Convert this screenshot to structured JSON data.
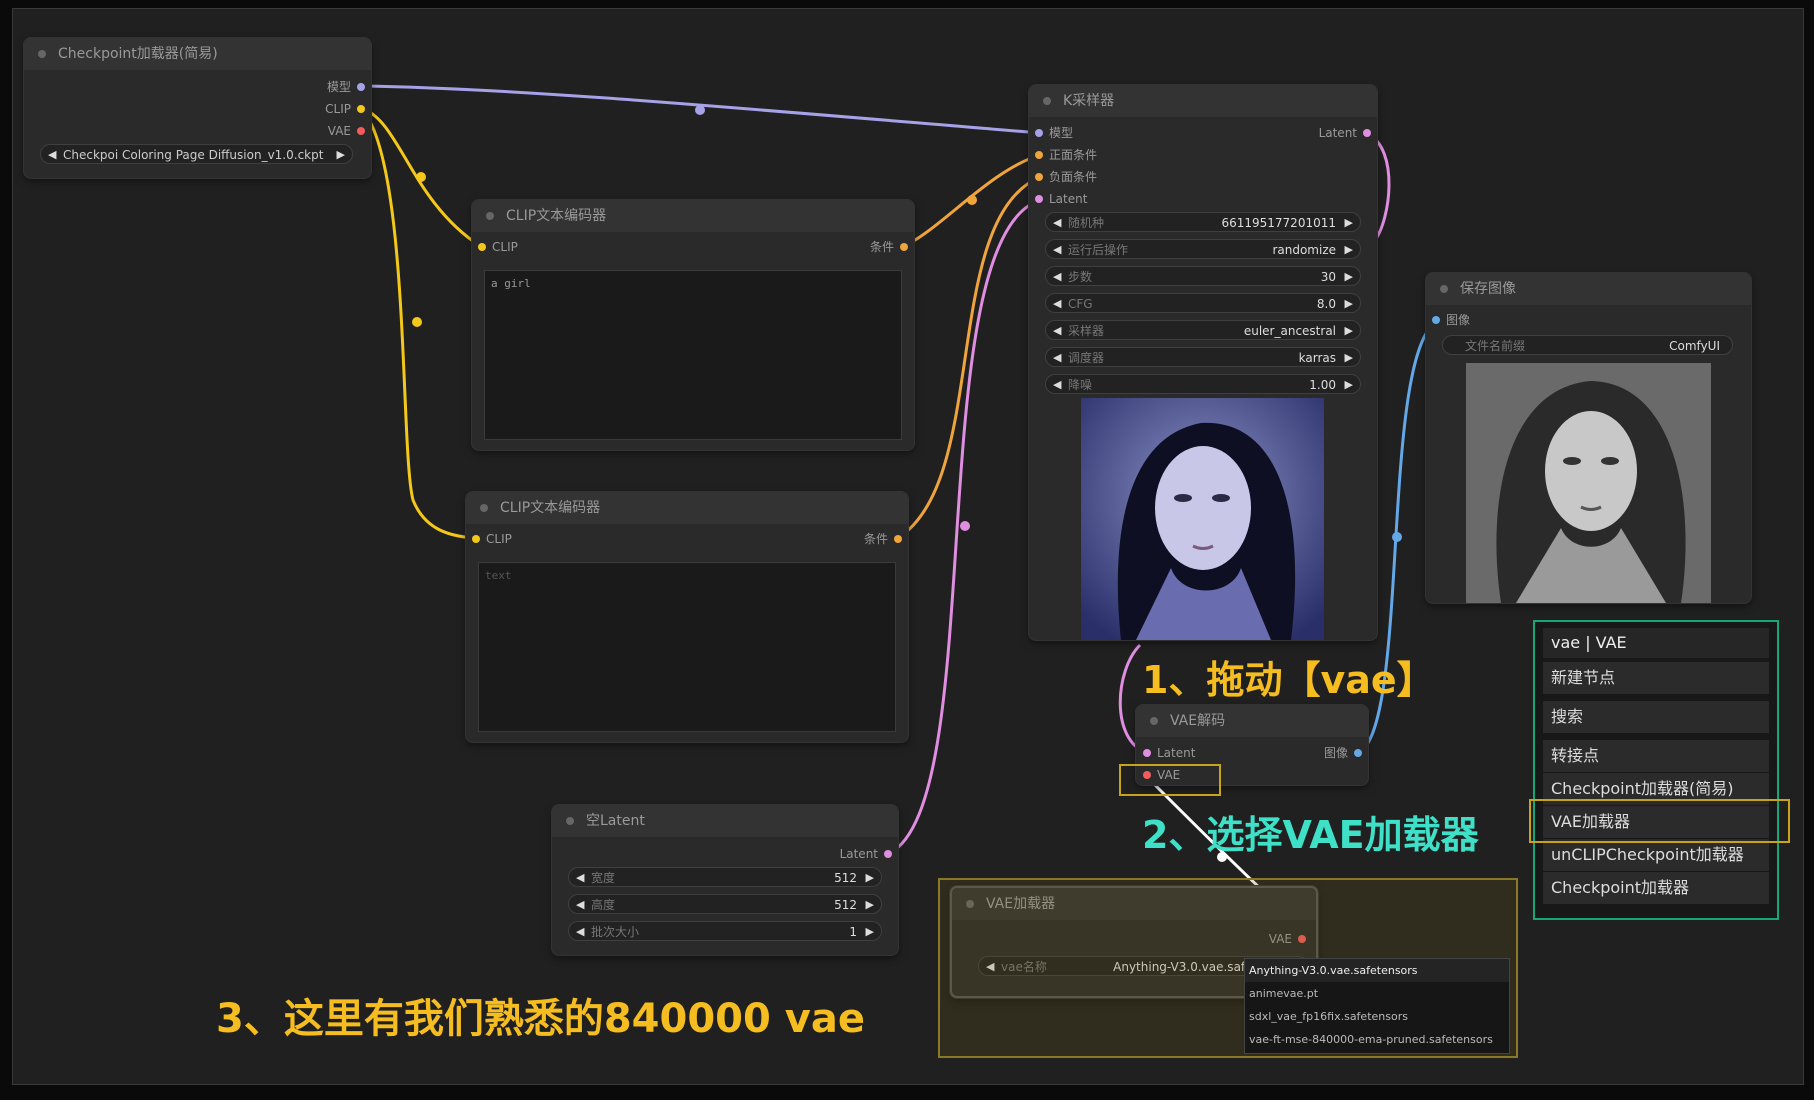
{
  "nodes": {
    "checkpoint": {
      "title": "Checkpoint加载器(简易)",
      "out_model": "模型",
      "out_clip": "CLIP",
      "out_vae": "VAE",
      "ckpt_value": "Checkpoi Coloring Page Diffusion_v1.0.ckpt"
    },
    "clip_pos": {
      "title": "CLIP文本编码器",
      "in_clip": "CLIP",
      "out_cond": "条件",
      "text": "a girl"
    },
    "clip_neg": {
      "title": "CLIP文本编码器",
      "in_clip": "CLIP",
      "out_cond": "条件",
      "placeholder": "text"
    },
    "ksampler": {
      "title": "K采样器",
      "in_model": "模型",
      "in_positive": "正面条件",
      "in_negative": "负面条件",
      "in_latent": "Latent",
      "out_latent": "Latent",
      "widgets": [
        {
          "label": "随机种",
          "value": "661195177201011"
        },
        {
          "label": "运行后操作",
          "value": "randomize"
        },
        {
          "label": "步数",
          "value": "30"
        },
        {
          "label": "CFG",
          "value": "8.0"
        },
        {
          "label": "采样器",
          "value": "euler_ancestral"
        },
        {
          "label": "调度器",
          "value": "karras"
        },
        {
          "label": "降噪",
          "value": "1.00"
        }
      ]
    },
    "save_image": {
      "title": "保存图像",
      "in_image": "图像",
      "filename_label": "文件名前缀",
      "filename_value": "ComfyUI"
    },
    "vae_decode": {
      "title": "VAE解码",
      "in_latent": "Latent",
      "in_vae": "VAE",
      "out_image": "图像"
    },
    "empty_latent": {
      "title": "空Latent",
      "out_latent": "Latent",
      "widgets": [
        {
          "label": "宽度",
          "value": "512"
        },
        {
          "label": "高度",
          "value": "512"
        },
        {
          "label": "批次大小",
          "value": "1"
        }
      ]
    },
    "vae_loader": {
      "title": "VAE加载器",
      "out_vae": "VAE",
      "widget_label": "vae名称",
      "widget_value": "Anything-V3.0.vae.safetensors"
    }
  },
  "dropdown": {
    "options": [
      "Anything-V3.0.vae.safetensors",
      "animevae.pt",
      "sdxl_vae_fp16fix.safetensors",
      "vae-ft-mse-840000-ema-pruned.safetensors"
    ],
    "selected_index": 0
  },
  "search_menu": {
    "query": "vae | VAE",
    "items": [
      "新建节点",
      "搜索",
      "转接点",
      "Checkpoint加载器(简易)",
      "VAE加载器",
      "unCLIPCheckpoint加载器",
      "Checkpoint加载器"
    ],
    "highlighted_index": 4
  },
  "annotations": {
    "step1": "1、拖动【vae】",
    "step2": "2、选择VAE加载器",
    "step3": "3、这里有我们熟悉的840000 vae"
  },
  "colors": {
    "model_wire": "#a7a1e8",
    "clip_wire": "#f4c81b",
    "cond_wire": "#f0a43c",
    "latent_wire": "#e08ee0",
    "image_wire": "#64a8e8",
    "vae_wire": "#f25c5c",
    "drag_wire": "#ffffff",
    "annotation_yellow": "#f5bd1f",
    "annotation_cyan": "#3fe0c8",
    "highlight_box": "#c8a41c",
    "menu_border": "#17a57a"
  }
}
